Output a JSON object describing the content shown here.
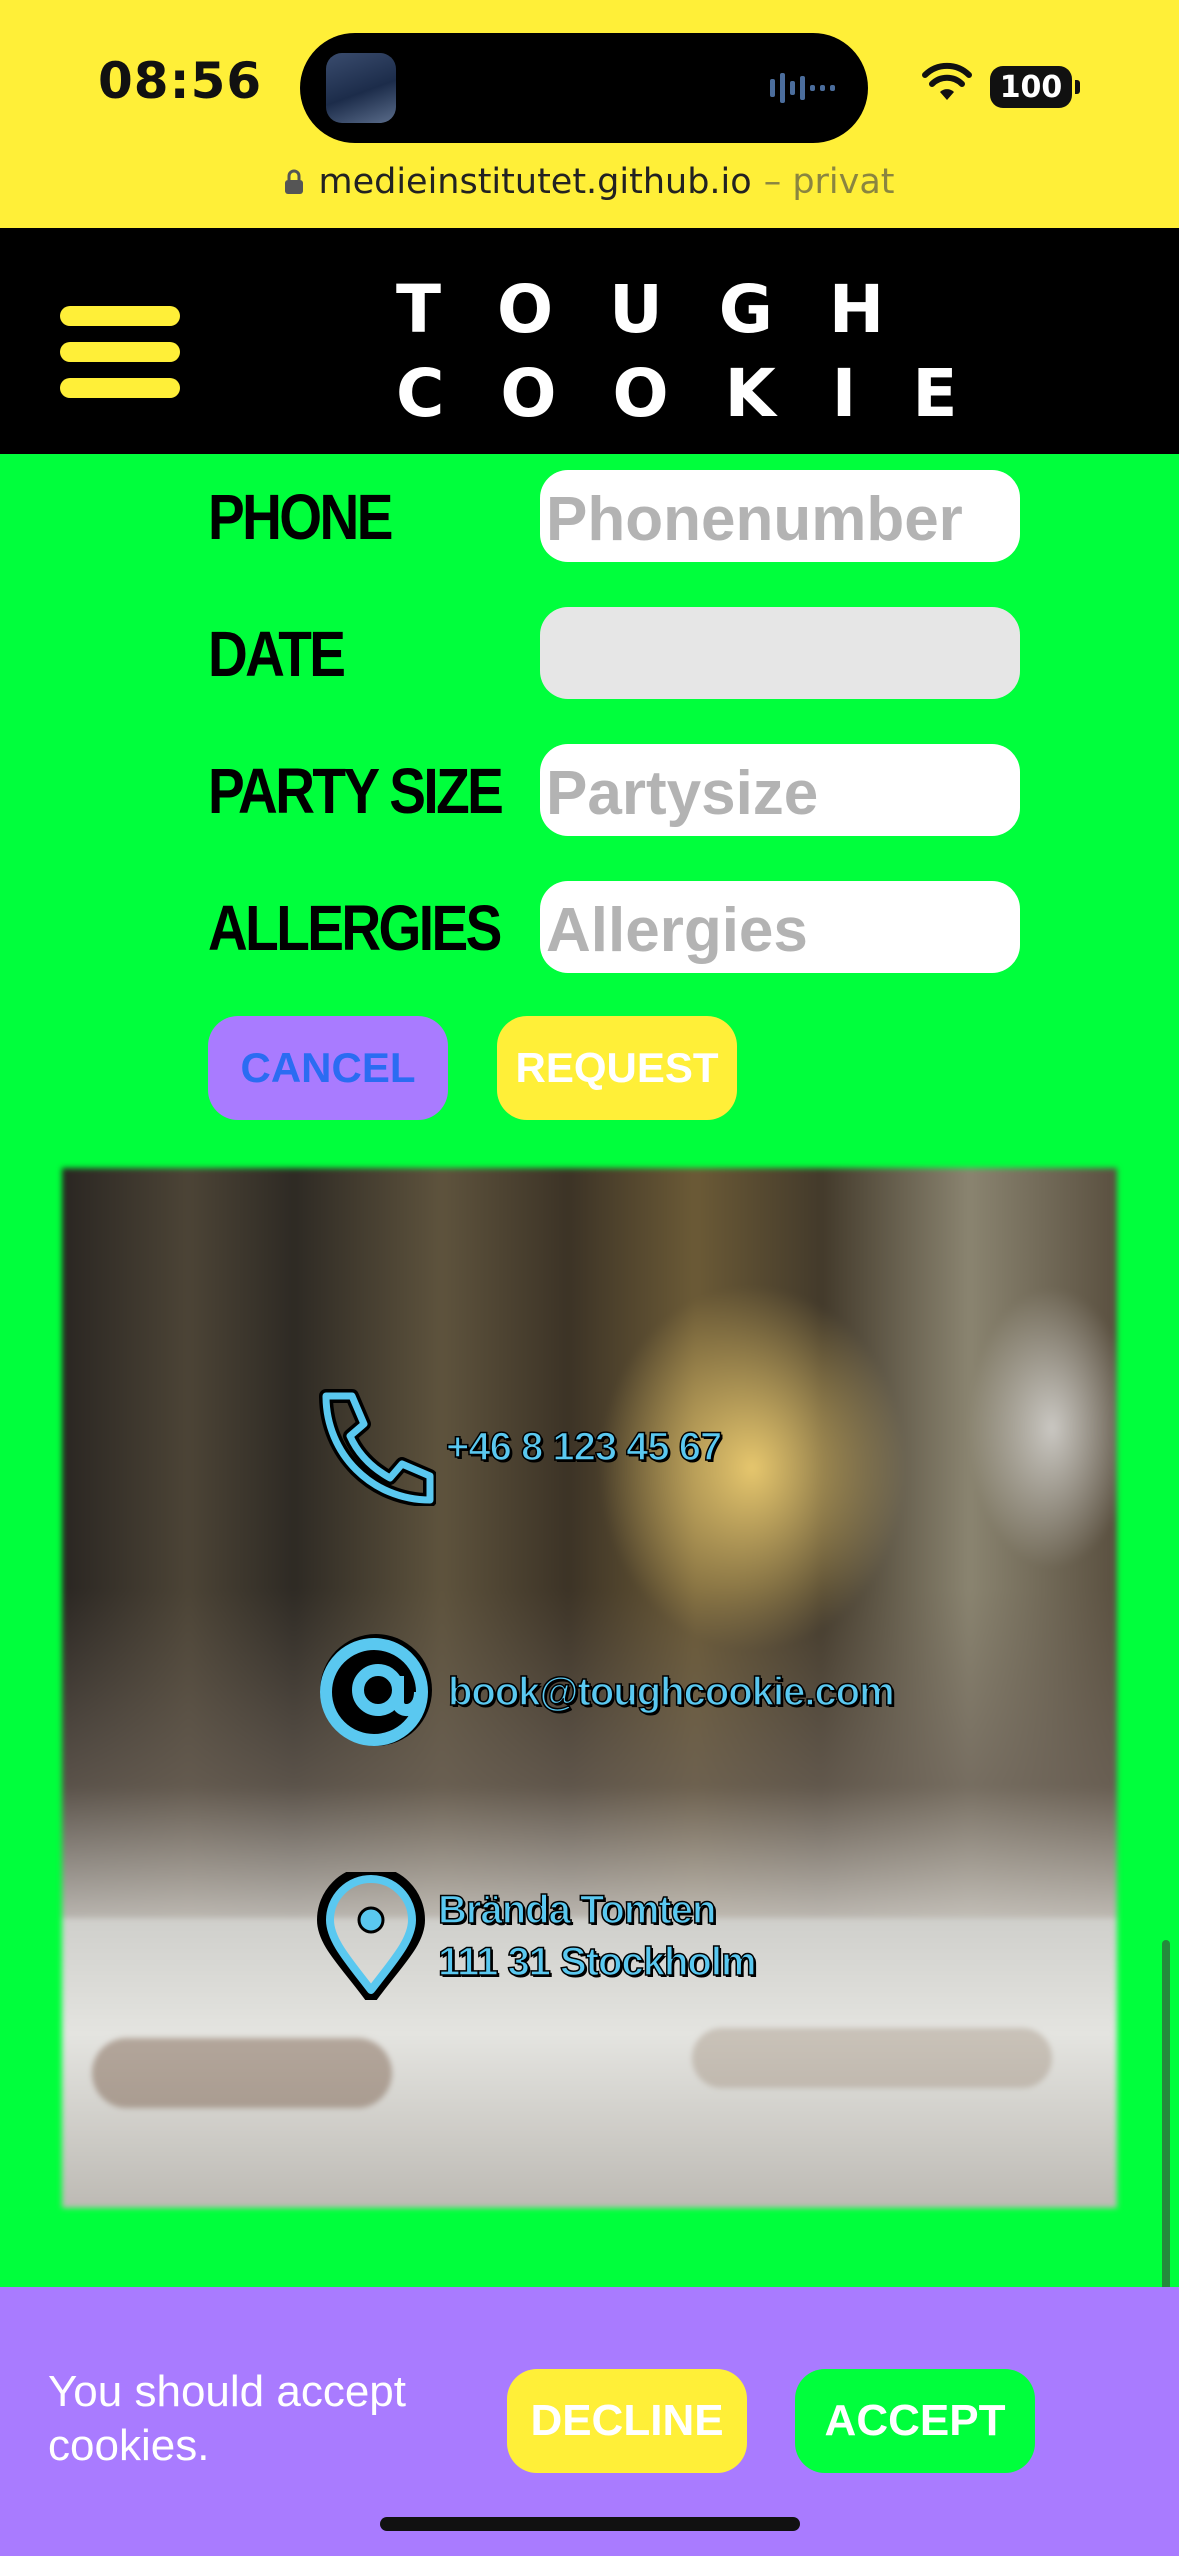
{
  "status_bar": {
    "time": "08:56",
    "battery": "100"
  },
  "url_bar": {
    "domain": "medieinstitutet.github.io",
    "mode": "– privat"
  },
  "header": {
    "logo_line1": "TOUGH",
    "logo_line2": "COOKIE"
  },
  "form": {
    "phone": {
      "label": "PHONE",
      "placeholder": "Phonenumber"
    },
    "date": {
      "label": "DATE",
      "placeholder": ""
    },
    "party_size": {
      "label": "PARTY SIZE",
      "placeholder": "Partysize"
    },
    "allergies": {
      "label": "ALLERGIES",
      "placeholder": "Allergies"
    },
    "cancel_label": "CANCEL",
    "request_label": "REQUEST"
  },
  "contact": {
    "phone": "+46 8 123 45 67",
    "email": "book@toughcookie.com",
    "address_line1": "Brända Tomten",
    "address_line2": "111 31 Stockholm"
  },
  "cookie_banner": {
    "text": "You should accept cookies.",
    "decline_label": "DECLINE",
    "accept_label": "ACCEPT"
  },
  "colors": {
    "yellow": "#ffef38",
    "green": "#00ff3c",
    "purple": "#a97bff",
    "black": "#000000",
    "contact_blue": "#5ac8f0"
  },
  "icons": [
    "lock-icon",
    "wifi-icon",
    "hamburger-menu-icon",
    "phone-icon",
    "at-sign-icon",
    "location-pin-icon"
  ]
}
